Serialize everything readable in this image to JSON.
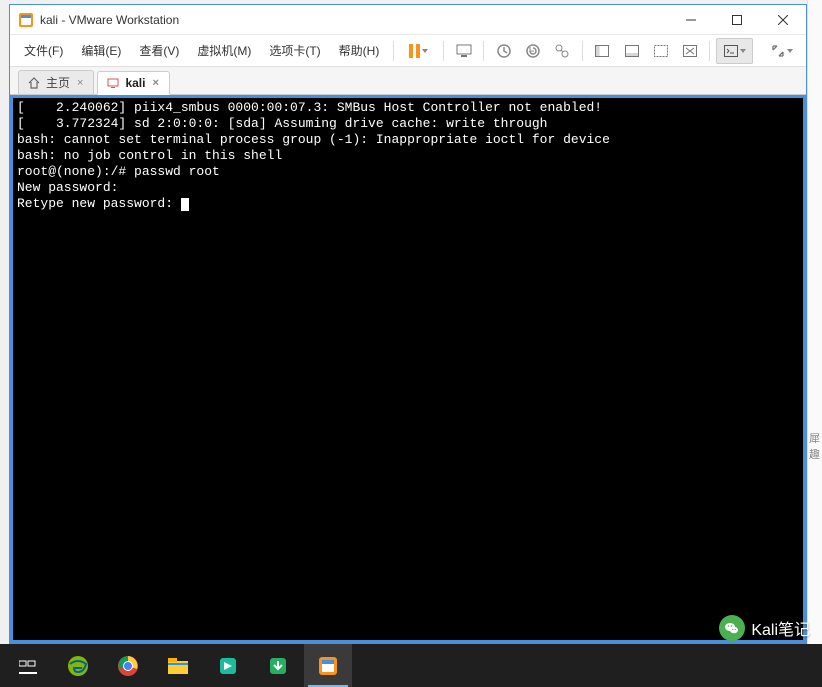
{
  "window": {
    "title": "kali - VMware Workstation"
  },
  "menu": {
    "file": "文件(F)",
    "edit": "编辑(E)",
    "view": "查看(V)",
    "vm": "虚拟机(M)",
    "tabs": "选项卡(T)",
    "help": "帮助(H)"
  },
  "tabs": {
    "home": "主页",
    "kali": "kali"
  },
  "terminal": {
    "lines": [
      "[    2.240062] piix4_smbus 0000:00:07.3: SMBus Host Controller not enabled!",
      "[    3.772324] sd 2:0:0:0: [sda] Assuming drive cache: write through",
      "bash: cannot set terminal process group (-1): Inappropriate ioctl for device",
      "bash: no job control in this shell",
      "root@(none):/# passwd root",
      "New password:",
      "Retype new password: "
    ]
  },
  "right_hint": {
    "l1": "犀",
    "l2": "趣"
  },
  "watermark": {
    "text": "Kali笔记"
  }
}
